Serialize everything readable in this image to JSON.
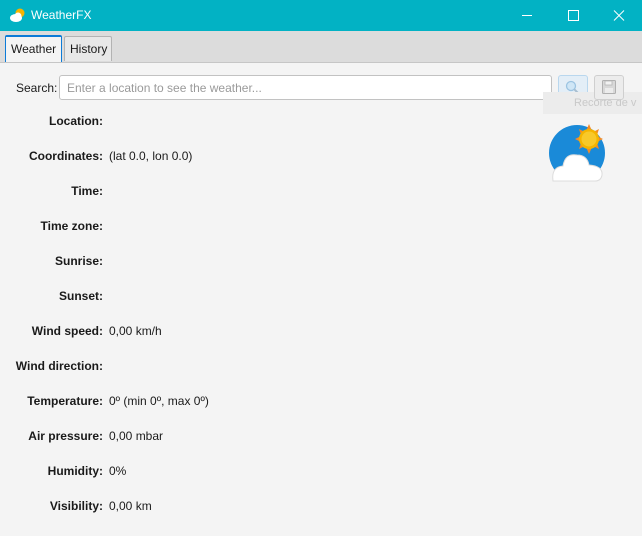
{
  "window": {
    "title": "WeatherFX",
    "app_icon": "sun-cloud-icon",
    "controls": [
      "minimize-icon",
      "maximize-icon",
      "close-icon"
    ],
    "accent_color": "#02b2c4"
  },
  "tabs": [
    {
      "label": "Weather",
      "selected": true
    },
    {
      "label": "History",
      "selected": false
    }
  ],
  "search": {
    "label": "Search:",
    "value": "",
    "placeholder": "Enter a location to see the weather...",
    "search_button_icon": "search-icon",
    "save_button_icon": "save-icon",
    "tooltip": "Recorte de v"
  },
  "weather_icon": "partly-cloudy-icon",
  "fields": {
    "location": {
      "label": "Location:",
      "value": ""
    },
    "coordinates": {
      "label": "Coordinates:",
      "value": "(lat 0.0, lon 0.0)"
    },
    "time": {
      "label": "Time:",
      "value": ""
    },
    "time_zone": {
      "label": "Time zone:",
      "value": ""
    },
    "sunrise": {
      "label": "Sunrise:",
      "value": ""
    },
    "sunset": {
      "label": "Sunset:",
      "value": ""
    },
    "wind_speed": {
      "label": "Wind speed:",
      "value": "0,00 km/h"
    },
    "wind_direction": {
      "label": "Wind direction:",
      "value": ""
    },
    "temperature": {
      "label": "Temperature:",
      "value": "0º (min 0º, max 0º)"
    },
    "air_pressure": {
      "label": "Air pressure:",
      "value": "0,00 mbar"
    },
    "humidity": {
      "label": "Humidity:",
      "value": "0%"
    },
    "visibility": {
      "label": "Visibility:",
      "value": "0,00 km"
    }
  }
}
